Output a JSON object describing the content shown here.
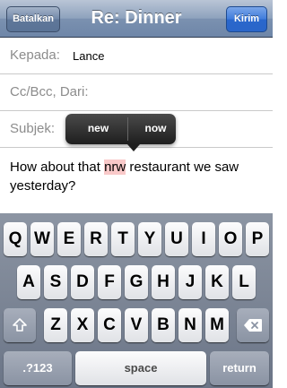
{
  "navbar": {
    "cancel_label": "Batalkan",
    "title": "Re: Dinner",
    "send_label": "Kirim"
  },
  "fields": {
    "to_label": "Kepada:",
    "to_value": "Lance",
    "ccbcc_label": "Cc/Bcc, Dari:",
    "subject_label": "Subjek:"
  },
  "suggestions": {
    "option1": "new",
    "option2": "now"
  },
  "message": {
    "before": "How about that ",
    "misspelled": "nrw",
    "after": " restaurant we saw yesterday?"
  },
  "keyboard": {
    "row1": [
      "Q",
      "W",
      "E",
      "R",
      "T",
      "Y",
      "U",
      "I",
      "O",
      "P"
    ],
    "row2": [
      "A",
      "S",
      "D",
      "F",
      "G",
      "H",
      "J",
      "K",
      "L"
    ],
    "row3": [
      "Z",
      "X",
      "C",
      "V",
      "B",
      "N",
      "M"
    ],
    "numbers_label": ".?123",
    "space_label": "space",
    "return_label": "return",
    "shift_icon": "shift-arrow",
    "delete_icon": "backspace"
  }
}
